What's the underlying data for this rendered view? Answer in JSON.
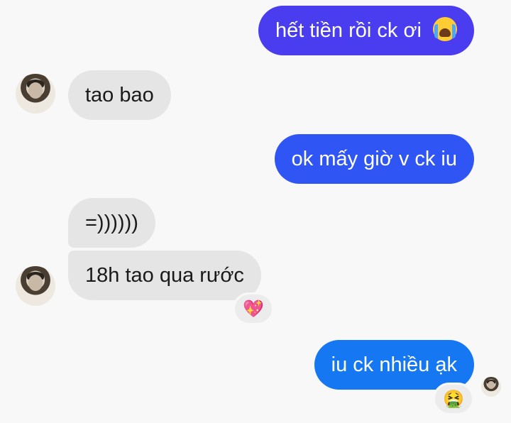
{
  "messages": [
    {
      "text": "hết tiền rồi ck ơi",
      "emoji": "loudly-crying-face",
      "from": "me"
    },
    {
      "text": "tao bao",
      "from": "them"
    },
    {
      "text": "ok mấy giờ v ck iu",
      "from": "me"
    },
    {
      "text": "=))))))",
      "from": "them"
    },
    {
      "text": "18h tao qua rước",
      "from": "them",
      "reaction": "💖"
    },
    {
      "text": "iu ck nhiều ạk",
      "from": "me",
      "reaction": "🤮"
    }
  ],
  "colors": {
    "sent_top": "#4a3df0",
    "sent_mid": "#2f55f5",
    "sent_bottom": "#1677f2",
    "received": "#e5e5e5",
    "background": "#f8f8f8"
  }
}
